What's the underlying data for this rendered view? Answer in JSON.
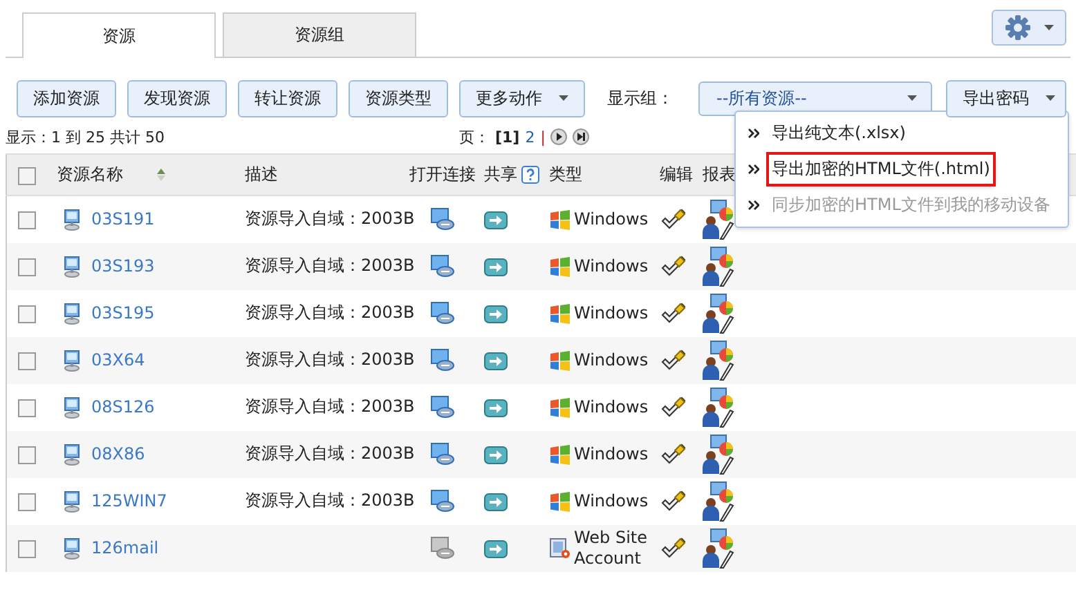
{
  "tabs": [
    {
      "label": "资源",
      "selected": true
    },
    {
      "label": "资源组",
      "selected": false
    }
  ],
  "toolbar": {
    "buttons": [
      {
        "label": "添加资源",
        "dropdown": false
      },
      {
        "label": "发现资源",
        "dropdown": false
      },
      {
        "label": "转让资源",
        "dropdown": false
      },
      {
        "label": "资源类型",
        "dropdown": false
      },
      {
        "label": "更多动作",
        "dropdown": true
      }
    ],
    "group_label": "显示组：",
    "group_select": "--所有资源--",
    "export_button": "导出密码"
  },
  "export_menu": [
    {
      "label": "导出纯文本(.xlsx)",
      "selected": false,
      "disabled": false
    },
    {
      "label": "导出加密的HTML文件(.html)",
      "selected": true,
      "disabled": false
    },
    {
      "label": "同步加密的HTML文件到我的移动设备",
      "selected": false,
      "disabled": true
    }
  ],
  "summary": "显示：1 到 25 共计 50",
  "pagination": {
    "label": "页：",
    "current": "[1]",
    "pages": [
      "2"
    ],
    "separator": "|"
  },
  "table": {
    "select_all_checked": false,
    "columns": [
      "资源名称",
      "描述",
      "打开连接",
      "共享",
      "类型",
      "编辑",
      "报表"
    ],
    "rows": [
      {
        "checked": false,
        "name": "03S191",
        "description": "资源导入自域：2003B",
        "connect_enabled": true,
        "kind": "windows",
        "type": "Windows"
      },
      {
        "checked": false,
        "name": "03S193",
        "description": "资源导入自域：2003B",
        "connect_enabled": true,
        "kind": "windows",
        "type": "Windows"
      },
      {
        "checked": false,
        "name": "03S195",
        "description": "资源导入自域：2003B",
        "connect_enabled": true,
        "kind": "windows",
        "type": "Windows"
      },
      {
        "checked": false,
        "name": "03X64",
        "description": "资源导入自域：2003B",
        "connect_enabled": true,
        "kind": "windows",
        "type": "Windows"
      },
      {
        "checked": false,
        "name": "08S126",
        "description": "资源导入自域：2003B",
        "connect_enabled": true,
        "kind": "windows",
        "type": "Windows"
      },
      {
        "checked": false,
        "name": "08X86",
        "description": "资源导入自域：2003B",
        "connect_enabled": true,
        "kind": "windows",
        "type": "Windows"
      },
      {
        "checked": false,
        "name": "125WIN7",
        "description": "资源导入自域：2003B",
        "connect_enabled": true,
        "kind": "windows",
        "type": "Windows"
      },
      {
        "checked": false,
        "name": "126mail",
        "connect_enabled": false,
        "kind": "website",
        "type": "Web Site Account"
      }
    ]
  }
}
